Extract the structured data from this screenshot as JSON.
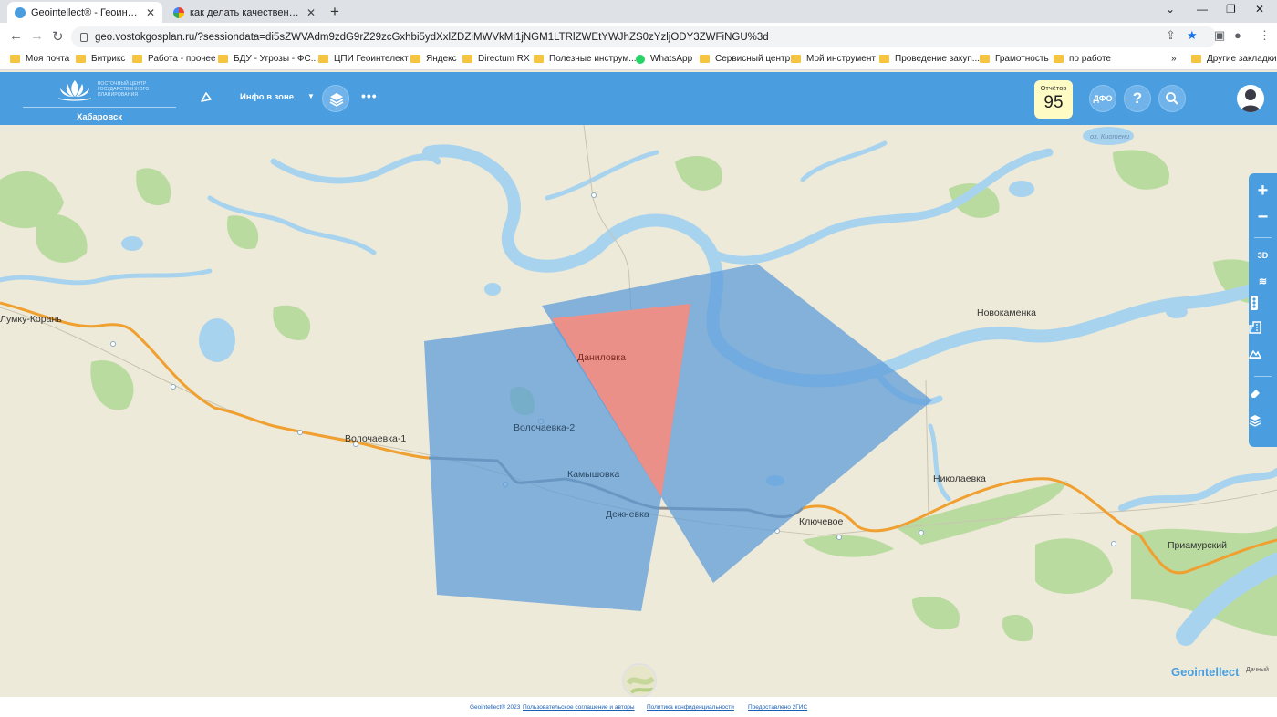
{
  "browser": {
    "tabs": [
      {
        "title": "Geointellect® - Геоинформацио",
        "active": true
      },
      {
        "title": "как делать качественные снимк",
        "active": false
      }
    ],
    "new_tab": "+",
    "url": "geo.vostokgosplan.ru/?sessiondata=di5sZWVAdm9zdG9rZ29zcGxhbi5ydXxlZDZiMWVkMi1jNGM1LTRlZWEtYWJhZS0zYzljODY3ZWFiNGU%3d",
    "bookmarks": [
      {
        "label": "Моя почта",
        "icon": "folder"
      },
      {
        "label": "Битрикс",
        "icon": "folder"
      },
      {
        "label": "Работа - прочее",
        "icon": "folder"
      },
      {
        "label": "БДУ - Угрозы - ФС...",
        "icon": "folder"
      },
      {
        "label": "ЦПИ Геоинтелект",
        "icon": "folder"
      },
      {
        "label": "Яндекс",
        "icon": "folder"
      },
      {
        "label": "Directum RX",
        "icon": "folder"
      },
      {
        "label": "Полезные инструм...",
        "icon": "folder"
      },
      {
        "label": "WhatsApp",
        "icon": "whatsapp"
      },
      {
        "label": "Сервисный центр",
        "icon": "folder"
      },
      {
        "label": "Мой инструмент",
        "icon": "folder"
      },
      {
        "label": "Проведение закуп...",
        "icon": "folder"
      },
      {
        "label": "Грамотность",
        "icon": "folder"
      },
      {
        "label": "по работе",
        "icon": "folder"
      }
    ],
    "bookmarks_more": "»",
    "other_bookmarks": "Другие закладки"
  },
  "app": {
    "logo_text": "ВОСТОЧНЫЙ ЦЕНТР ГОСУДАРСТВЕННОГО ПЛАНИРОВАНИЯ",
    "city": "Хабаровск",
    "zone_info": "Инфо в зоне",
    "more": "•••",
    "reports_label": "Отчётов",
    "reports_count": "95",
    "dfo_label": "ДФО",
    "help_label": "?"
  },
  "map": {
    "places": [
      {
        "name": "Лумку-Корань"
      },
      {
        "name": "Волочаевка-1"
      },
      {
        "name": "Волочаевка-2"
      },
      {
        "name": "Даниловка"
      },
      {
        "name": "Камышовка"
      },
      {
        "name": "Дежневка"
      },
      {
        "name": "Ключевое"
      },
      {
        "name": "Новокаменка"
      },
      {
        "name": "Николаевка"
      },
      {
        "name": "Приамурский"
      },
      {
        "name": "оз. Киотени"
      }
    ],
    "tools": {
      "zoom_in": "+",
      "zoom_out": "−",
      "three_d": "3D"
    },
    "colors": {
      "polygon_blue": "#5b9bd8",
      "polygon_red": "#f08a80",
      "water": "#a8d3ef",
      "forest": "#b6d99a",
      "railway": "#f0a030",
      "road": "#8a8a8a"
    },
    "brand": "Geointellect",
    "brand_suffix": "Дачный"
  },
  "footer": {
    "copyright": "Geointellect® 2023",
    "link1": "Пользовательское соглашение и авторы",
    "link2": "Политика конфиденциальности",
    "link3": "Предоставлено 2ГИС"
  }
}
